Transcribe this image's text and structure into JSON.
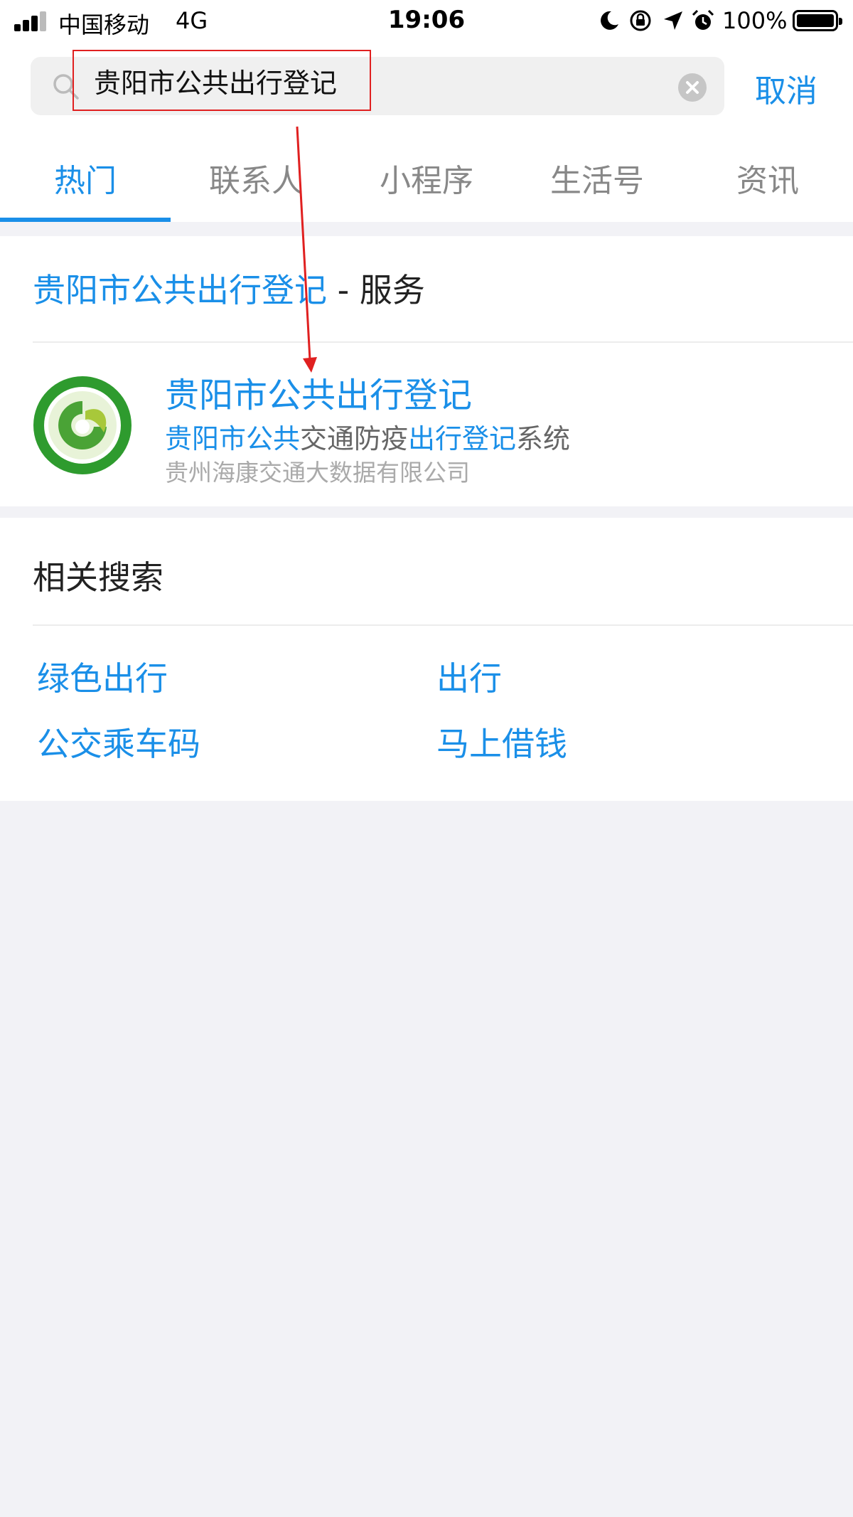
{
  "status_bar": {
    "carrier": "中国移动",
    "network": "4G",
    "time": "19:06",
    "battery": "100%",
    "icons": [
      "signal-icon",
      "moon-icon",
      "orientation-lock-icon",
      "location-icon",
      "alarm-icon",
      "battery-icon"
    ]
  },
  "search": {
    "query": "贵阳市公共出行登记",
    "cancel_label": "取消"
  },
  "tabs": [
    {
      "label": "热门",
      "active": true
    },
    {
      "label": "联系人",
      "active": false
    },
    {
      "label": "小程序",
      "active": false
    },
    {
      "label": "生活号",
      "active": false
    },
    {
      "label": "资讯",
      "active": false
    }
  ],
  "service_section": {
    "title_highlight": "贵阳市公共出行登记",
    "title_suffix": " - 服务",
    "result": {
      "name": "贵阳市公共出行登记",
      "desc_parts": [
        "贵阳市公共",
        "交通防疫",
        "出行登记",
        "系统"
      ],
      "company": "贵州海康交通大数据有限公司"
    }
  },
  "related": {
    "title": "相关搜索",
    "items": [
      "绿色出行",
      "出行",
      "公交乘车码",
      "马上借钱"
    ]
  },
  "colors": {
    "accent": "#1a8fe8",
    "annotation": "#e02020",
    "background": "#f2f2f6"
  }
}
